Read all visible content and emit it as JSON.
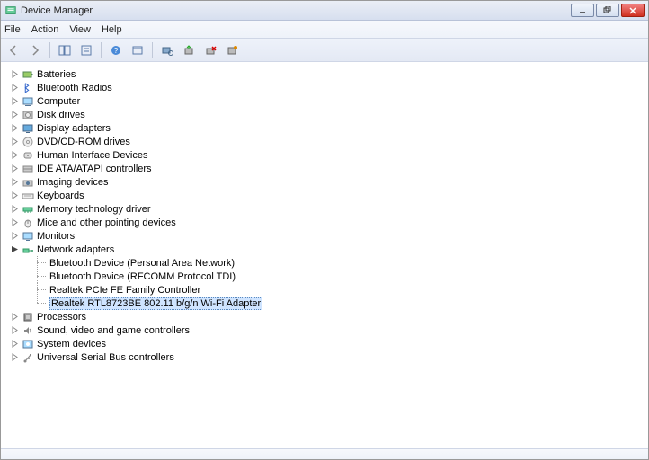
{
  "window": {
    "title": "Device Manager"
  },
  "menu": {
    "file": "File",
    "action": "Action",
    "view": "View",
    "help": "Help"
  },
  "tree": {
    "categories": [
      {
        "label": "Batteries",
        "icon": "battery"
      },
      {
        "label": "Bluetooth Radios",
        "icon": "bluetooth"
      },
      {
        "label": "Computer",
        "icon": "computer"
      },
      {
        "label": "Disk drives",
        "icon": "disk"
      },
      {
        "label": "Display adapters",
        "icon": "display"
      },
      {
        "label": "DVD/CD-ROM drives",
        "icon": "dvd"
      },
      {
        "label": "Human Interface Devices",
        "icon": "hid"
      },
      {
        "label": "IDE ATA/ATAPI controllers",
        "icon": "ide"
      },
      {
        "label": "Imaging devices",
        "icon": "imaging"
      },
      {
        "label": "Keyboards",
        "icon": "keyboard"
      },
      {
        "label": "Memory technology driver",
        "icon": "memory"
      },
      {
        "label": "Mice and other pointing devices",
        "icon": "mouse"
      },
      {
        "label": "Monitors",
        "icon": "monitor"
      },
      {
        "label": "Network adapters",
        "icon": "network",
        "expanded": true,
        "children": [
          {
            "label": "Bluetooth Device (Personal Area Network)"
          },
          {
            "label": "Bluetooth Device (RFCOMM Protocol TDI)"
          },
          {
            "label": "Realtek PCIe FE Family Controller"
          },
          {
            "label": "Realtek RTL8723BE 802.11 b/g/n Wi-Fi Adapter",
            "selected": true
          }
        ]
      },
      {
        "label": "Processors",
        "icon": "processor"
      },
      {
        "label": "Sound, video and game controllers",
        "icon": "sound"
      },
      {
        "label": "System devices",
        "icon": "system"
      },
      {
        "label": "Universal Serial Bus controllers",
        "icon": "usb"
      }
    ]
  }
}
